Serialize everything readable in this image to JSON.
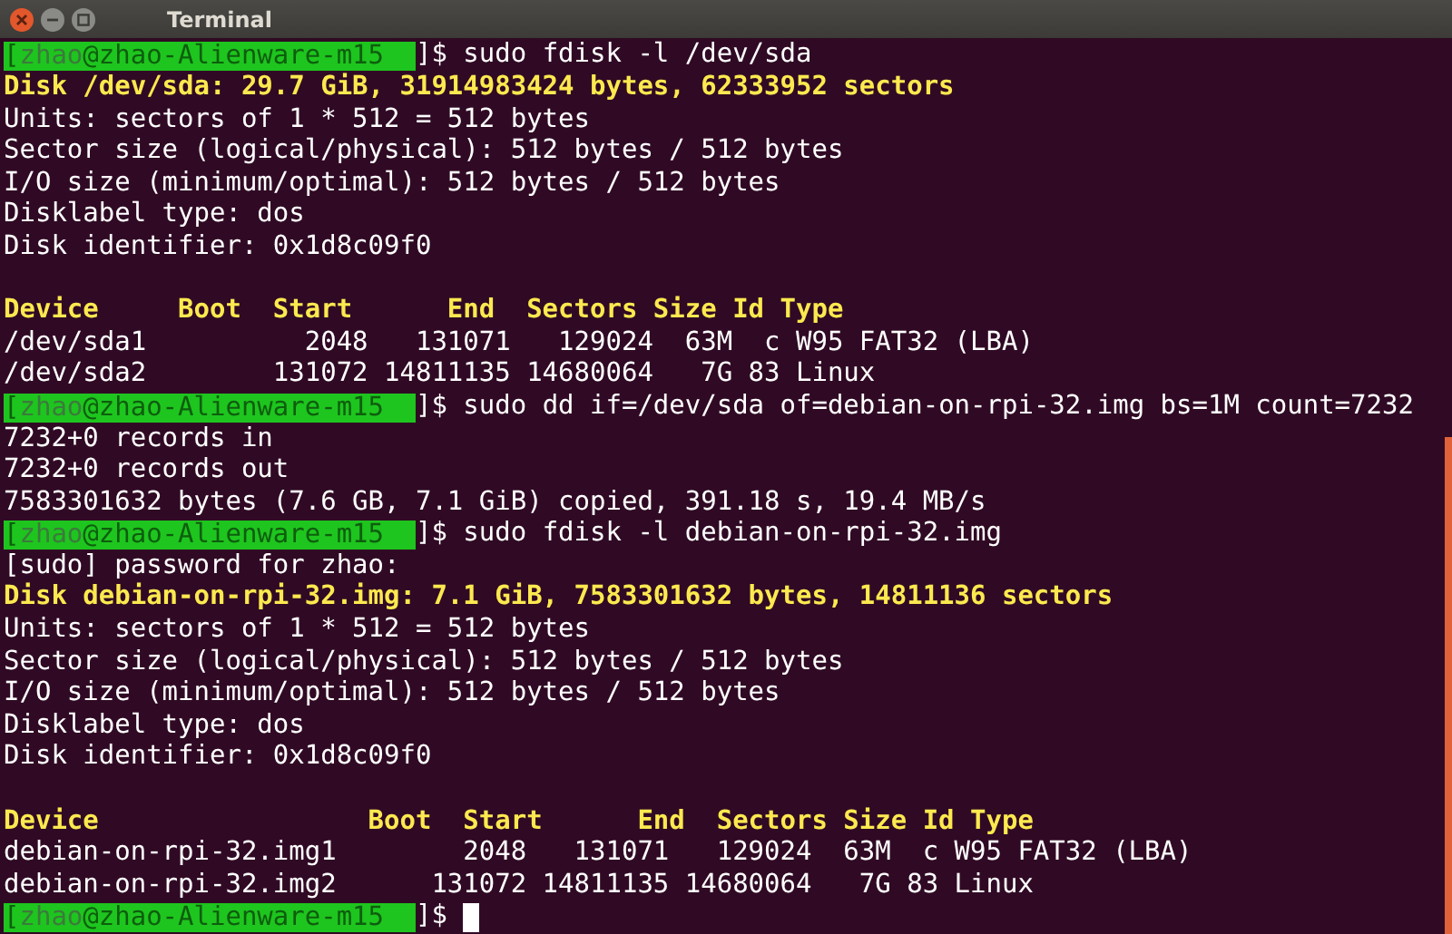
{
  "window": {
    "title": "Terminal"
  },
  "lines": [
    {
      "kind": "prompt",
      "open": "[",
      "user": "zhao",
      "host": "@zhao-Alienware-m15",
      "text": "]$ sudo fdisk -l /dev/sda",
      "cursor": false
    },
    {
      "kind": "bold",
      "text": "Disk /dev/sda: 29.7 GiB, 31914983424 bytes, 62333952 sectors"
    },
    {
      "kind": "plain",
      "text": "Units: sectors of 1 * 512 = 512 bytes"
    },
    {
      "kind": "plain",
      "text": "Sector size (logical/physical): 512 bytes / 512 bytes"
    },
    {
      "kind": "plain",
      "text": "I/O size (minimum/optimal): 512 bytes / 512 bytes"
    },
    {
      "kind": "plain",
      "text": "Disklabel type: dos"
    },
    {
      "kind": "plain",
      "text": "Disk identifier: 0x1d8c09f0"
    },
    {
      "kind": "blank"
    },
    {
      "kind": "bold",
      "text": "Device     Boot  Start      End  Sectors Size Id Type"
    },
    {
      "kind": "plain",
      "text": "/dev/sda1          2048   131071   129024  63M  c W95 FAT32 (LBA)"
    },
    {
      "kind": "plain",
      "text": "/dev/sda2        131072 14811135 14680064   7G 83 Linux"
    },
    {
      "kind": "prompt",
      "open": "[",
      "user": "zhao",
      "host": "@zhao-Alienware-m15",
      "text": "]$ sudo dd if=/dev/sda of=debian-on-rpi-32.img bs=1M count=7232",
      "cursor": false
    },
    {
      "kind": "plain",
      "text": "7232+0 records in"
    },
    {
      "kind": "plain",
      "text": "7232+0 records out"
    },
    {
      "kind": "plain",
      "text": "7583301632 bytes (7.6 GB, 7.1 GiB) copied, 391.18 s, 19.4 MB/s"
    },
    {
      "kind": "prompt",
      "open": "[",
      "user": "zhao",
      "host": "@zhao-Alienware-m15",
      "text": "]$ sudo fdisk -l debian-on-rpi-32.img",
      "cursor": false
    },
    {
      "kind": "plain",
      "text": "[sudo] password for zhao:"
    },
    {
      "kind": "bold",
      "text": "Disk debian-on-rpi-32.img: 7.1 GiB, 7583301632 bytes, 14811136 sectors"
    },
    {
      "kind": "plain",
      "text": "Units: sectors of 1 * 512 = 512 bytes"
    },
    {
      "kind": "plain",
      "text": "Sector size (logical/physical): 512 bytes / 512 bytes"
    },
    {
      "kind": "plain",
      "text": "I/O size (minimum/optimal): 512 bytes / 512 bytes"
    },
    {
      "kind": "plain",
      "text": "Disklabel type: dos"
    },
    {
      "kind": "plain",
      "text": "Disk identifier: 0x1d8c09f0"
    },
    {
      "kind": "blank"
    },
    {
      "kind": "bold",
      "text": "Device                 Boot  Start      End  Sectors Size Id Type"
    },
    {
      "kind": "plain",
      "text": "debian-on-rpi-32.img1        2048   131071   129024  63M  c W95 FAT32 (LBA)"
    },
    {
      "kind": "plain",
      "text": "debian-on-rpi-32.img2      131072 14811135 14680064   7G 83 Linux"
    },
    {
      "kind": "prompt",
      "open": "[",
      "user": "zhao",
      "host": "@zhao-Alienware-m15",
      "text": "]$",
      "cursor": true
    }
  ]
}
